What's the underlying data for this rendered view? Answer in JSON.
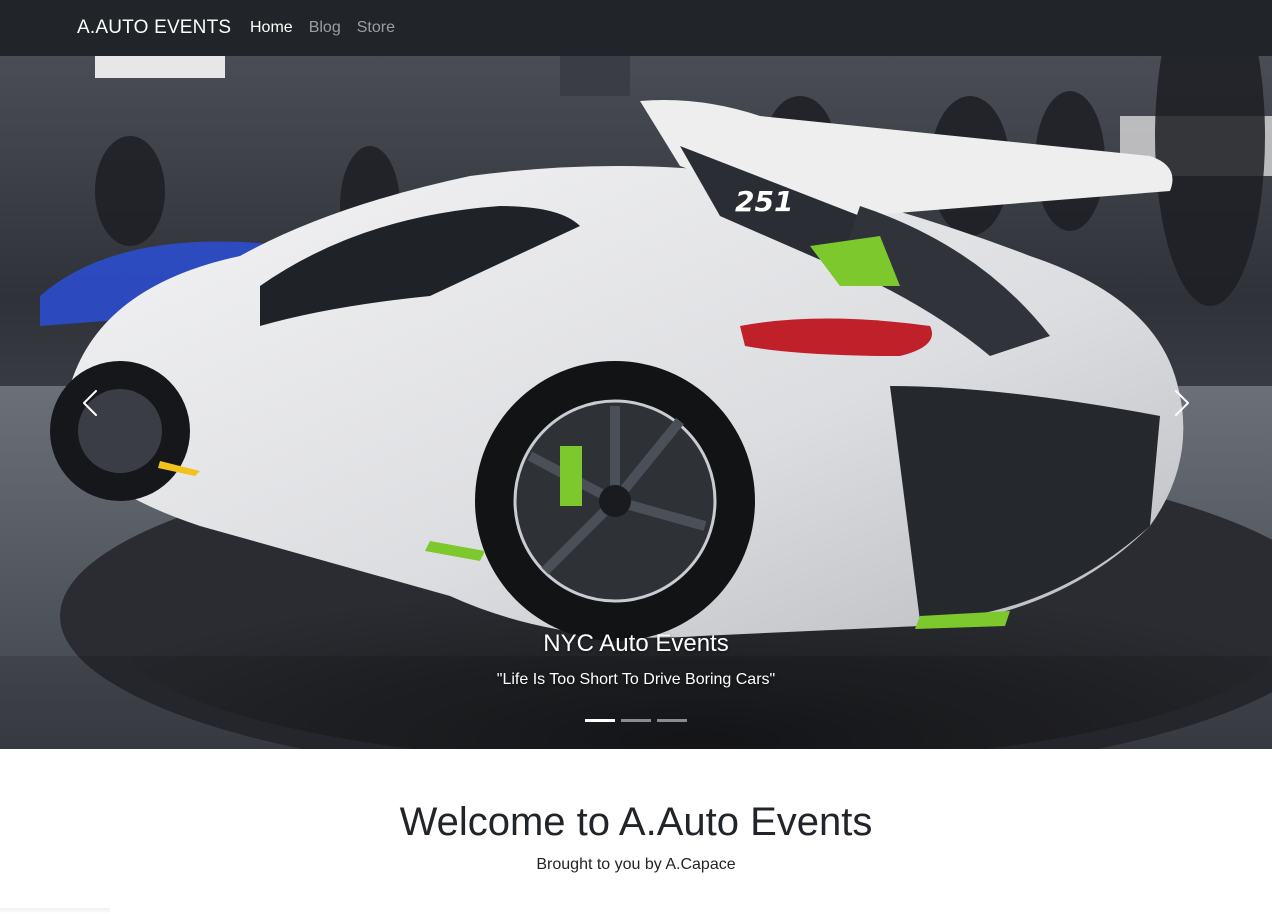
{
  "navbar": {
    "brand": "A.AUTO EVENTS",
    "links": [
      {
        "label": "Home",
        "active": true
      },
      {
        "label": "Blog",
        "active": false
      },
      {
        "label": "Store",
        "active": false
      }
    ],
    "background": "#212529"
  },
  "carousel": {
    "slide": {
      "title": "NYC Auto Events",
      "text": "\"Life Is Too Short To Drive Boring Cars\"",
      "car_badge": "251"
    },
    "indicators_count": 3,
    "active_indicator": 1,
    "prev_icon": "chevron-left-icon",
    "next_icon": "chevron-right-icon"
  },
  "welcome": {
    "heading": "Welcome to A.Auto Events",
    "subheading": "Brought to you by A.Capace"
  }
}
